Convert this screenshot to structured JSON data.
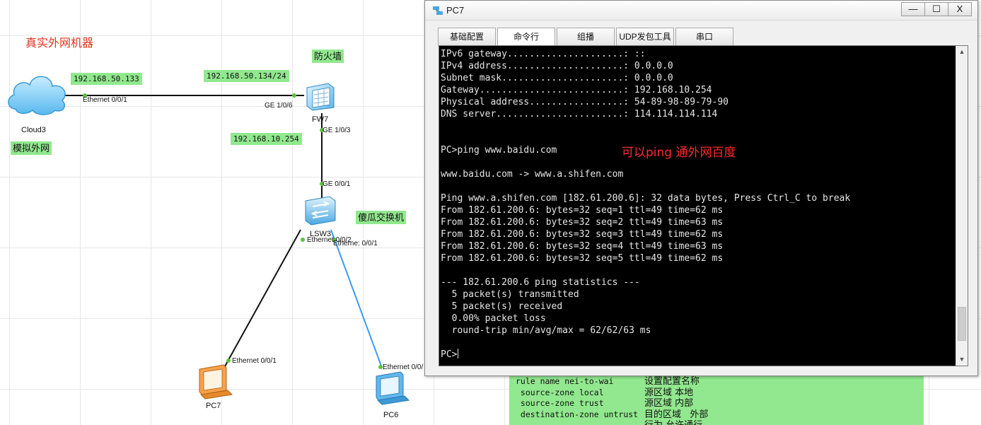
{
  "topology": {
    "annotations": {
      "real_external": "真实外网机器",
      "firewall": "防火墙",
      "dumb_switch": "傻瓜交换机",
      "simulated_external": "模拟外网"
    },
    "ip_tags": {
      "cloud_ip": "192.168.50.133",
      "fw_outside_ip": "192.168.50.134/24",
      "fw_inside_ip": "192.168.10.254"
    },
    "devices": {
      "cloud": "Cloud3",
      "firewall": "FW7",
      "switch": "LSW3",
      "pc7": "PC7",
      "pc6": "PC6"
    },
    "ports": {
      "cloud_eth": "Ethernet 0/0/1",
      "fw_ge106": "GE 1/0/6",
      "fw_ge103": "GE 1/0/3",
      "sw_ge001": "GE 0/0/1",
      "sw_eth002": "Ethernet 0/0/2",
      "sw_eth001": "Etherne: 0/0/1",
      "pc7_eth": "Ethernet 0/0/1",
      "pc6_eth": "Ethernet 0/0/"
    },
    "link_colors": {
      "copper": "#111111",
      "pc6_link": "#3b9cf0",
      "port_dot": "#58c43c"
    },
    "config_note": [
      {
        "code": "rule name nei-to-wai",
        "comment": "设置配置名称"
      },
      {
        "code": " source-zone local",
        "comment": "源区域 本地"
      },
      {
        "code": " source-zone trust",
        "comment": "源区域 内部"
      },
      {
        "code": " destination-zone untrust",
        "comment": "目的区域   外部"
      },
      {
        "code": "                        ",
        "comment": "行为 允许通行"
      }
    ]
  },
  "window": {
    "title": "PC7",
    "controls": {
      "minimize": "—",
      "maximize": "☐",
      "close": "X"
    },
    "tabs": [
      "基础配置",
      "命令行",
      "组播",
      "UDP发包工具",
      "串口"
    ],
    "active_tab": "命令行",
    "terminal": {
      "lines": [
        "IPv6 gateway.....................: ::",
        "IPv4 address.....................: 0.0.0.0",
        "Subnet mask......................: 0.0.0.0",
        "Gateway..........................: 192.168.10.254",
        "Physical address.................: 54-89-98-89-79-90",
        "DNS server.......................: 114.114.114.114",
        "",
        "",
        "PC>ping www.baidu.com",
        "",
        "www.baidu.com -> www.a.shifen.com",
        "",
        "Ping www.a.shifen.com [182.61.200.6]: 32 data bytes, Press Ctrl_C to break",
        "From 182.61.200.6: bytes=32 seq=1 ttl=49 time=62 ms",
        "From 182.61.200.6: bytes=32 seq=2 ttl=49 time=63 ms",
        "From 182.61.200.6: bytes=32 seq=3 ttl=49 time=62 ms",
        "From 182.61.200.6: bytes=32 seq=4 ttl=49 time=63 ms",
        "From 182.61.200.6: bytes=32 seq=5 ttl=49 time=62 ms",
        "",
        "--- 182.61.200.6 ping statistics ---",
        "  5 packet(s) transmitted",
        "  5 packet(s) received",
        "  0.00% packet loss",
        "  round-trip min/avg/max = 62/62/63 ms",
        "",
        "PC>"
      ],
      "annotation": "可以ping 通外网百度",
      "scroll_position": 0.95
    }
  }
}
